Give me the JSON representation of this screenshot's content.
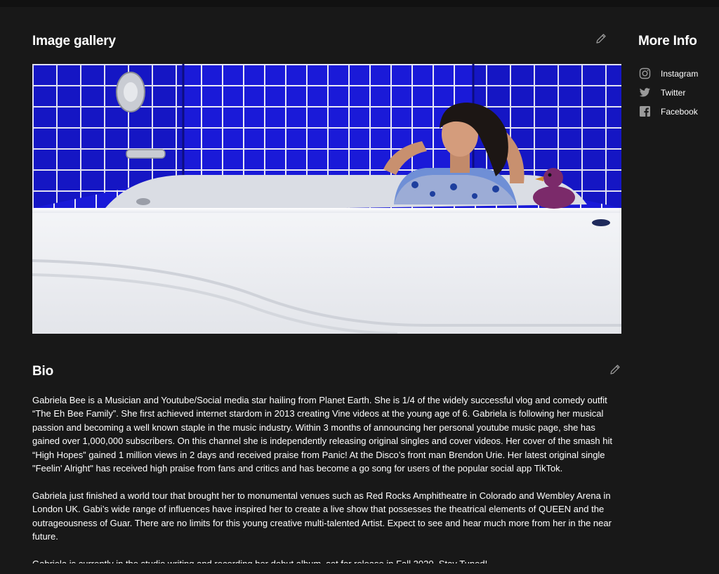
{
  "gallery": {
    "title": "Image gallery",
    "image_alt": "Woman in a white bathtub against blue tiled wall with a purple rubber duck"
  },
  "more_info": {
    "title": "More Info",
    "links": [
      {
        "label": "Instagram",
        "icon": "instagram-icon"
      },
      {
        "label": "Twitter",
        "icon": "twitter-icon"
      },
      {
        "label": "Facebook",
        "icon": "facebook-icon"
      }
    ]
  },
  "bio": {
    "title": "Bio",
    "paragraphs": [
      "Gabriela Bee is a Musician and Youtube/Social media star hailing from Planet Earth.  She is 1/4 of the widely successful vlog and comedy outfit “The Eh Bee Family”.  She first achieved internet stardom in 2013 creating Vine videos at the young age of 6.  Gabriela is following her musical passion and becoming a well known staple in the music industry. Within 3 months of announcing her personal youtube music page, she has gained over 1,000,000 subscribers. On this channel she is independently releasing original singles and cover videos. Her cover of the smash hit “High Hopes” gained 1 million views in 2 days and received praise from Panic! At the Disco’s front man Brendon Urie. Her latest original single \"Feelin' Alright\" has received high praise from fans and critics and has become a go song for users of the popular social app TikTok.",
      "Gabriela just finished a world tour that brought her to monumental venues such as Red Rocks Amphitheatre in Colorado and Wembley Arena in London UK. Gabi’s wide range of influences have inspired her to create a live show that possesses the theatrical elements of QUEEN and the outrageousness of Guar. There are no limits for this young creative multi-talented Artist. Expect to see and hear much more from her in the near future.",
      "Gabriela is currently in the studio writing and recording her debut album, set for release in Fall 2020. Stay Tuned!"
    ]
  },
  "colors": {
    "background": "#181818",
    "tile_blue": "#1a1ad8",
    "text": "#ffffff",
    "muted_icon": "#9a9a9a"
  }
}
